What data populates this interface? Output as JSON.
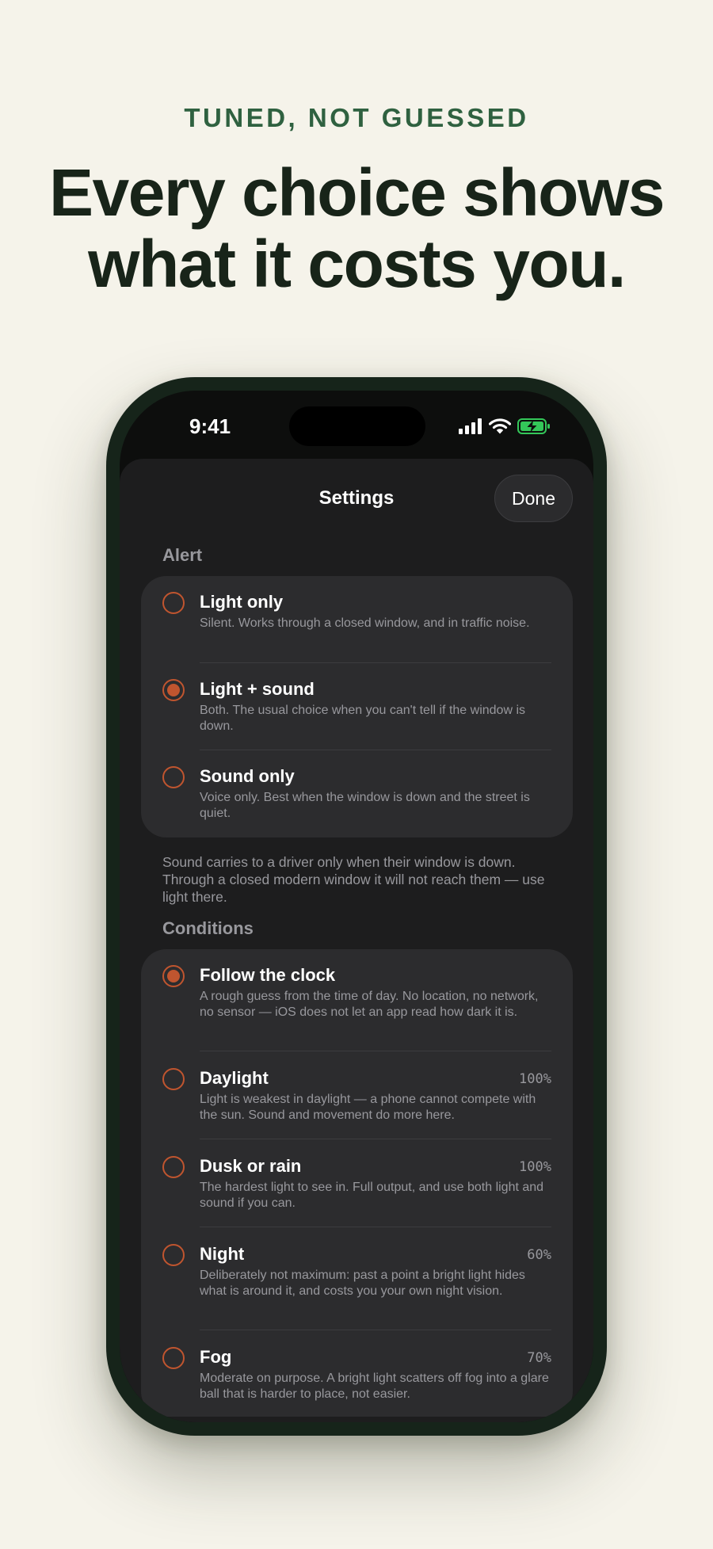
{
  "headline": {
    "eyebrow": "TUNED, NOT GUESSED",
    "title_line1": "Every choice shows",
    "title_line2": "what it costs you."
  },
  "status_bar": {
    "time": "9:41",
    "icons": [
      "cellular-signal-icon",
      "wifi-icon",
      "battery-charging-icon"
    ],
    "battery_color": "#34c759"
  },
  "nav": {
    "title": "Settings",
    "done_label": "Done"
  },
  "colors": {
    "accent": "#c0552f",
    "page_background": "#f5f3ea",
    "eyebrow": "#2f6140",
    "headline": "#182419",
    "phone_frame": "#16241a"
  },
  "alert": {
    "header": "Alert",
    "options": [
      {
        "title": "Light only",
        "description": "Silent. Works through a closed window, and in traffic noise.",
        "selected": false
      },
      {
        "title": "Light + sound",
        "description": "Both. The usual choice when you can't tell if the window is down.",
        "selected": true
      },
      {
        "title": "Sound only",
        "description": "Voice only. Best when the window is down and the street is quiet.",
        "selected": false
      }
    ],
    "footnote": "Sound carries to a driver only when their window is down. Through a closed modern window it will not reach them — use light there."
  },
  "conditions": {
    "header": "Conditions",
    "options": [
      {
        "title": "Follow the clock",
        "description": "A rough guess from the time of day. No location, no network, no sensor — iOS does not let an app read how dark it is.",
        "percent": "",
        "selected": true
      },
      {
        "title": "Daylight",
        "description": "Light is weakest in daylight — a phone cannot compete with the sun. Sound and movement do more here.",
        "percent": "100%",
        "selected": false
      },
      {
        "title": "Dusk or rain",
        "description": "The hardest light to see in. Full output, and use both light and sound if you can.",
        "percent": "100%",
        "selected": false
      },
      {
        "title": "Night",
        "description": "Deliberately not maximum: past a point a bright light hides what is around it, and costs you your own night vision.",
        "percent": "60%",
        "selected": false
      },
      {
        "title": "Fog",
        "description": "Moderate on purpose. A bright light scatters off fog into a glare ball that is harder to place, not easier.",
        "percent": "70%",
        "selected": false
      }
    ]
  }
}
